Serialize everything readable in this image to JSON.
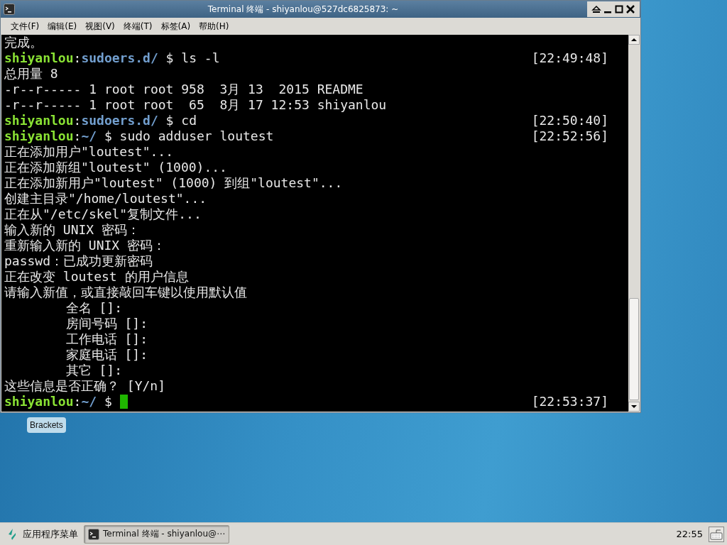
{
  "window": {
    "title": "Terminal 终端 - shiyanlou@527dc6825873: ~"
  },
  "menu": [
    "文件(F)",
    "编辑(E)",
    "视图(V)",
    "终端(T)",
    "标签(A)",
    "帮助(H)"
  ],
  "terminal": {
    "lines": [
      {
        "kind": "output",
        "text": "完成。"
      },
      {
        "kind": "prompt",
        "user": "shiyanlou",
        "separator": ":",
        "path": "sudoers.d/",
        "symbol": "$",
        "command": "ls -l",
        "time": "[22:49:48]",
        "cursor": false
      },
      {
        "kind": "output",
        "text": "总用量 8"
      },
      {
        "kind": "output",
        "text": "-r--r----- 1 root root 958  3月 13  2015 README"
      },
      {
        "kind": "output",
        "text": "-r--r----- 1 root root  65  8月 17 12:53 shiyanlou"
      },
      {
        "kind": "prompt",
        "user": "shiyanlou",
        "separator": ":",
        "path": "sudoers.d/",
        "symbol": "$",
        "command": "cd",
        "time": "[22:50:40]",
        "cursor": false
      },
      {
        "kind": "prompt",
        "user": "shiyanlou",
        "separator": ":",
        "path": "~/",
        "symbol": "$",
        "command": "sudo adduser loutest",
        "time": "[22:52:56]",
        "cursor": false
      },
      {
        "kind": "output",
        "text": "正在添加用户\"loutest\"..."
      },
      {
        "kind": "output",
        "text": "正在添加新组\"loutest\" (1000)..."
      },
      {
        "kind": "output",
        "text": "正在添加新用户\"loutest\" (1000) 到组\"loutest\"..."
      },
      {
        "kind": "output",
        "text": "创建主目录\"/home/loutest\"..."
      },
      {
        "kind": "output",
        "text": "正在从\"/etc/skel\"复制文件..."
      },
      {
        "kind": "output",
        "text": "输入新的 UNIX 密码："
      },
      {
        "kind": "output",
        "text": "重新输入新的 UNIX 密码："
      },
      {
        "kind": "output",
        "text": "passwd：已成功更新密码"
      },
      {
        "kind": "output",
        "text": "正在改变 loutest 的用户信息"
      },
      {
        "kind": "output",
        "text": "请输入新值，或直接敲回车键以使用默认值"
      },
      {
        "kind": "output",
        "text": "        全名 []:"
      },
      {
        "kind": "output",
        "text": "        房间号码 []:"
      },
      {
        "kind": "output",
        "text": "        工作电话 []:"
      },
      {
        "kind": "output",
        "text": "        家庭电话 []:"
      },
      {
        "kind": "output",
        "text": "        其它 []:"
      },
      {
        "kind": "output",
        "text": "这些信息是否正确？ [Y/n]"
      },
      {
        "kind": "prompt",
        "user": "shiyanlou",
        "separator": ":",
        "path": "~/",
        "symbol": "$",
        "time": "[22:53:37]",
        "cursor": true
      }
    ]
  },
  "desktop_icons": [
    {
      "label": "Brackets"
    }
  ],
  "taskbar": {
    "menu_label": "应用程序菜单",
    "tasks": [
      {
        "label": "Terminal 终端 - shiyanlou@⋯",
        "selected": true
      }
    ],
    "clock": "22:55"
  }
}
